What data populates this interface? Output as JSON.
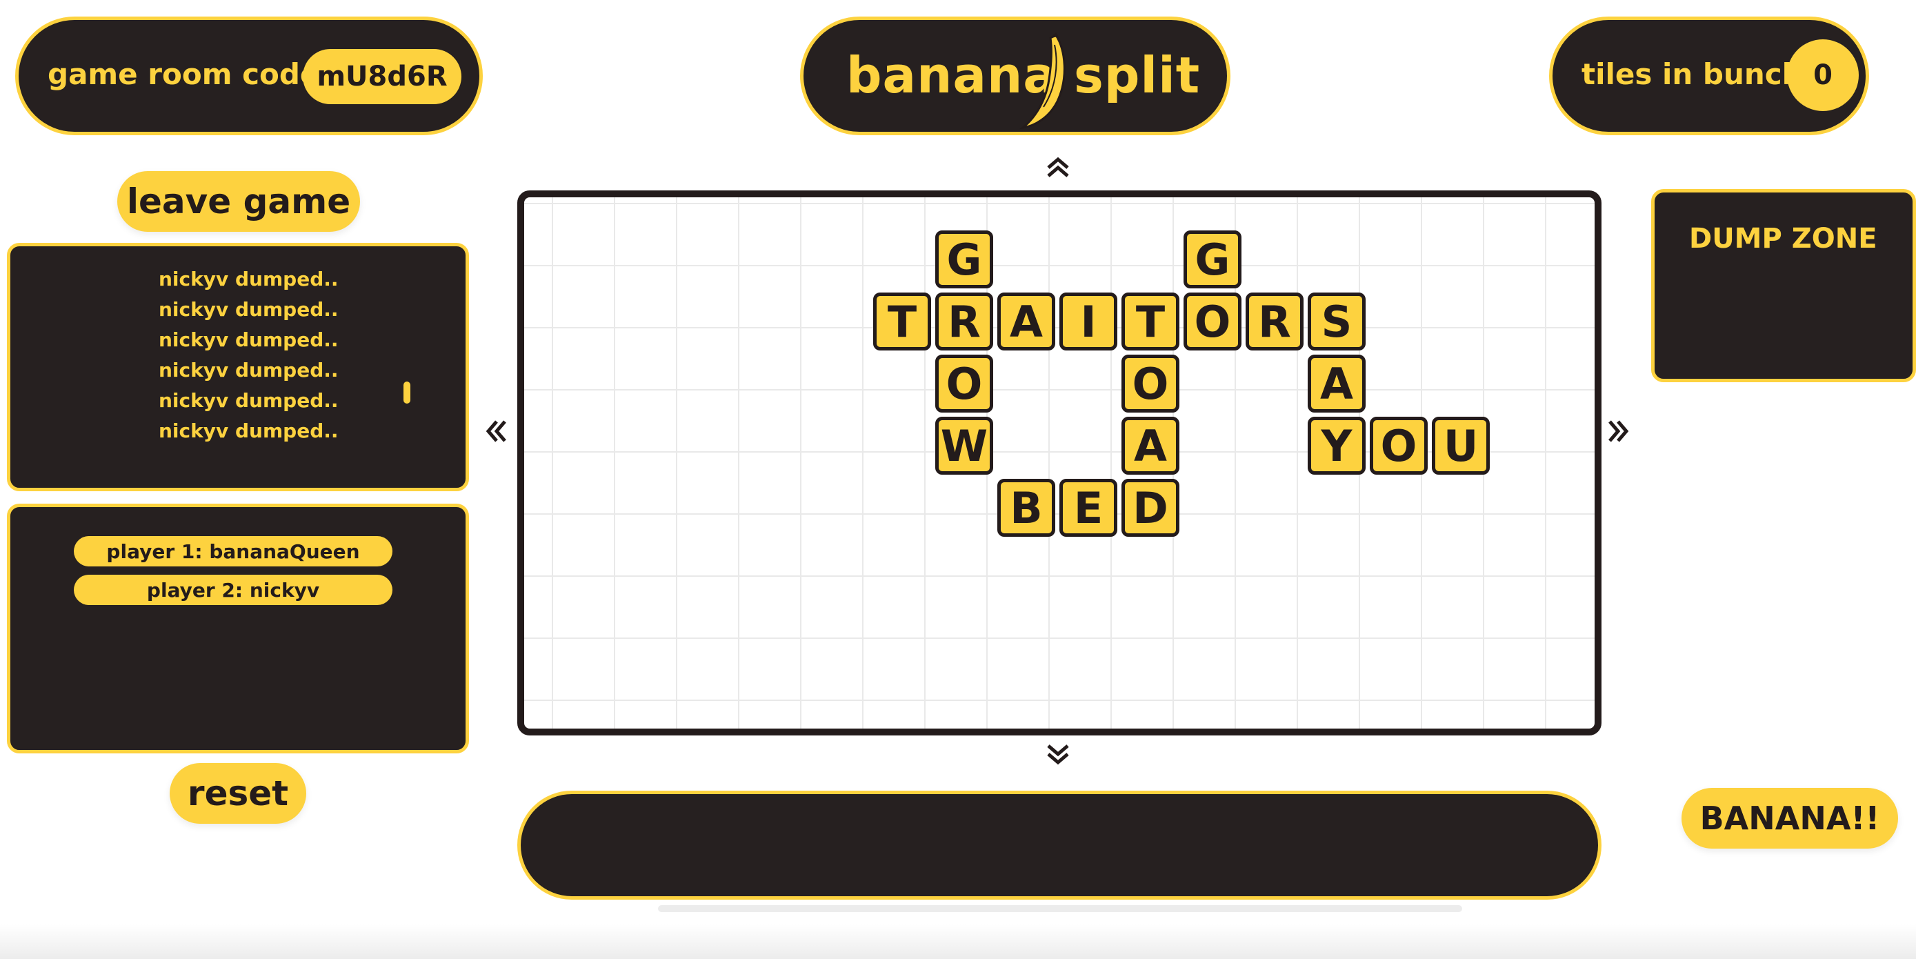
{
  "header": {
    "room_label": "game room code:",
    "room_code": "mU8d6R",
    "logo_left": "banana",
    "logo_right": "split",
    "bunch_label": "tiles in bunch:",
    "bunch_count": "0"
  },
  "sidebar": {
    "leave_label": "leave game",
    "log": [
      "nickyv dumped..",
      "nickyv dumped..",
      "nickyv dumped..",
      "nickyv dumped..",
      "nickyv dumped..",
      "nickyv dumped.."
    ],
    "players": [
      "player 1: bananaQueen",
      "player 2: nickyv"
    ],
    "reset_label": "reset"
  },
  "board": {
    "arrow_up": "«",
    "arrow_down": "«",
    "arrow_left": "«",
    "arrow_right": "»",
    "tiles": [
      {
        "letter": "G",
        "col": 1,
        "row": 0
      },
      {
        "letter": "G",
        "col": 5,
        "row": 0
      },
      {
        "letter": "T",
        "col": 0,
        "row": 1
      },
      {
        "letter": "R",
        "col": 1,
        "row": 1
      },
      {
        "letter": "A",
        "col": 2,
        "row": 1
      },
      {
        "letter": "I",
        "col": 3,
        "row": 1
      },
      {
        "letter": "T",
        "col": 4,
        "row": 1
      },
      {
        "letter": "O",
        "col": 5,
        "row": 1
      },
      {
        "letter": "R",
        "col": 6,
        "row": 1
      },
      {
        "letter": "S",
        "col": 7,
        "row": 1
      },
      {
        "letter": "O",
        "col": 1,
        "row": 2
      },
      {
        "letter": "O",
        "col": 4,
        "row": 2
      },
      {
        "letter": "A",
        "col": 7,
        "row": 2
      },
      {
        "letter": "W",
        "col": 1,
        "row": 3
      },
      {
        "letter": "A",
        "col": 4,
        "row": 3
      },
      {
        "letter": "Y",
        "col": 7,
        "row": 3
      },
      {
        "letter": "O",
        "col": 8,
        "row": 3
      },
      {
        "letter": "U",
        "col": 9,
        "row": 3
      },
      {
        "letter": "B",
        "col": 2,
        "row": 4
      },
      {
        "letter": "E",
        "col": 3,
        "row": 4
      },
      {
        "letter": "D",
        "col": 4,
        "row": 4
      }
    ]
  },
  "dump": {
    "label": "DUMP ZONE"
  },
  "actions": {
    "banana_label": "BANANA!!"
  },
  "colors": {
    "accent": "#fdd23f",
    "dark": "#262020",
    "text_dark": "#231b1b"
  }
}
